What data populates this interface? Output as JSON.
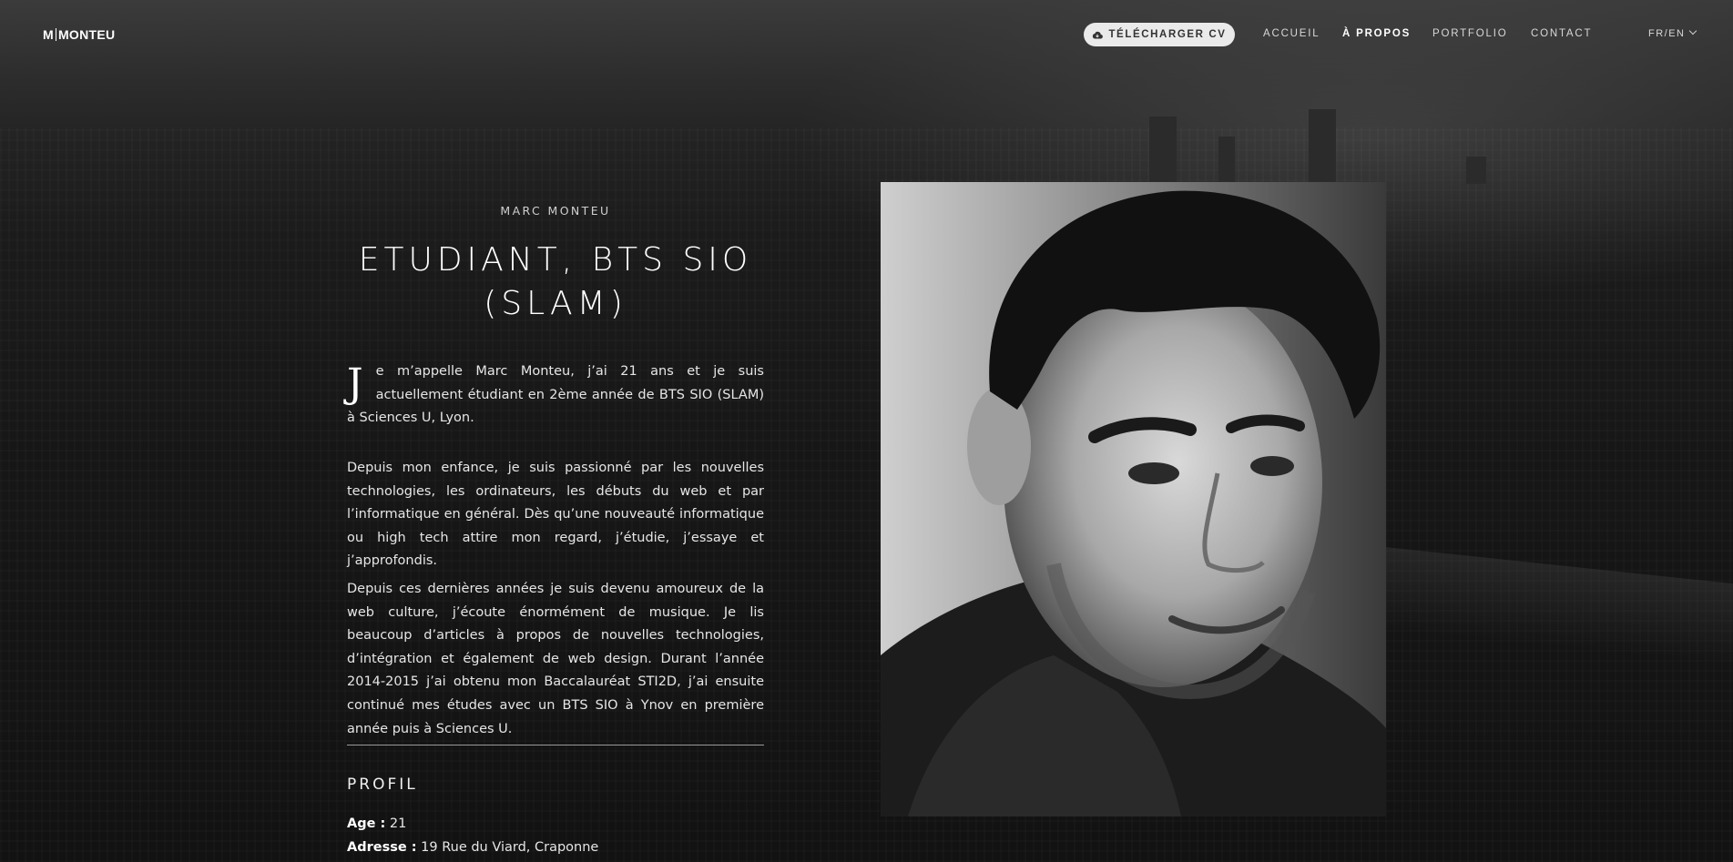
{
  "header": {
    "logo_left": "M",
    "logo_right": "MONTEU",
    "cv_button": "TÉLÉCHARGER CV",
    "nav": [
      "ACCUEIL",
      "À PROPOS",
      "PORTFOLIO",
      "CONTACT"
    ],
    "active_nav": "À PROPOS",
    "lang": "FR/EN"
  },
  "intro": {
    "eyebrow": "MARC MONTEU",
    "title_line1": "ETUDIANT, BTS SIO",
    "title_line2": "(SLAM)",
    "dropcap": "J",
    "p1_rest": "e m’appelle Marc Monteu, j’ai 21 ans et je suis actuellement étudiant en 2ème année de BTS SIO (SLAM) à Sciences U, Lyon.",
    "p2": "Depuis mon enfance, je suis passionné par les nouvelles technologies, les ordinateurs, les débuts du web et par l’informatique en général. Dès qu’une nouveauté informatique ou high tech attire mon regard, j’étudie, j’essaye et j’approfondis.",
    "p3": "Depuis ces dernières années je suis devenu amoureux de la web culture, j’écoute énormément de musique. Je lis beaucoup d’articles à propos de nouvelles technologies, d’intégration et également de web design. Durant l’année 2014-2015 j’ai obtenu mon Baccalauréat STI2D, j’ai ensuite continué mes études avec un BTS SIO à Ynov en première année puis à Sciences U."
  },
  "profil": {
    "heading": "PROFIL",
    "age_label": "Age :",
    "age_value": "21",
    "address_label": "Adresse :",
    "address_value": "19 Rue du Viard, Craponne"
  },
  "icons": {
    "cv": "cloud-download-icon",
    "lang": "chevron-down-icon"
  },
  "colors": {
    "background": "#141516",
    "button_bg": "#eaeaea"
  }
}
